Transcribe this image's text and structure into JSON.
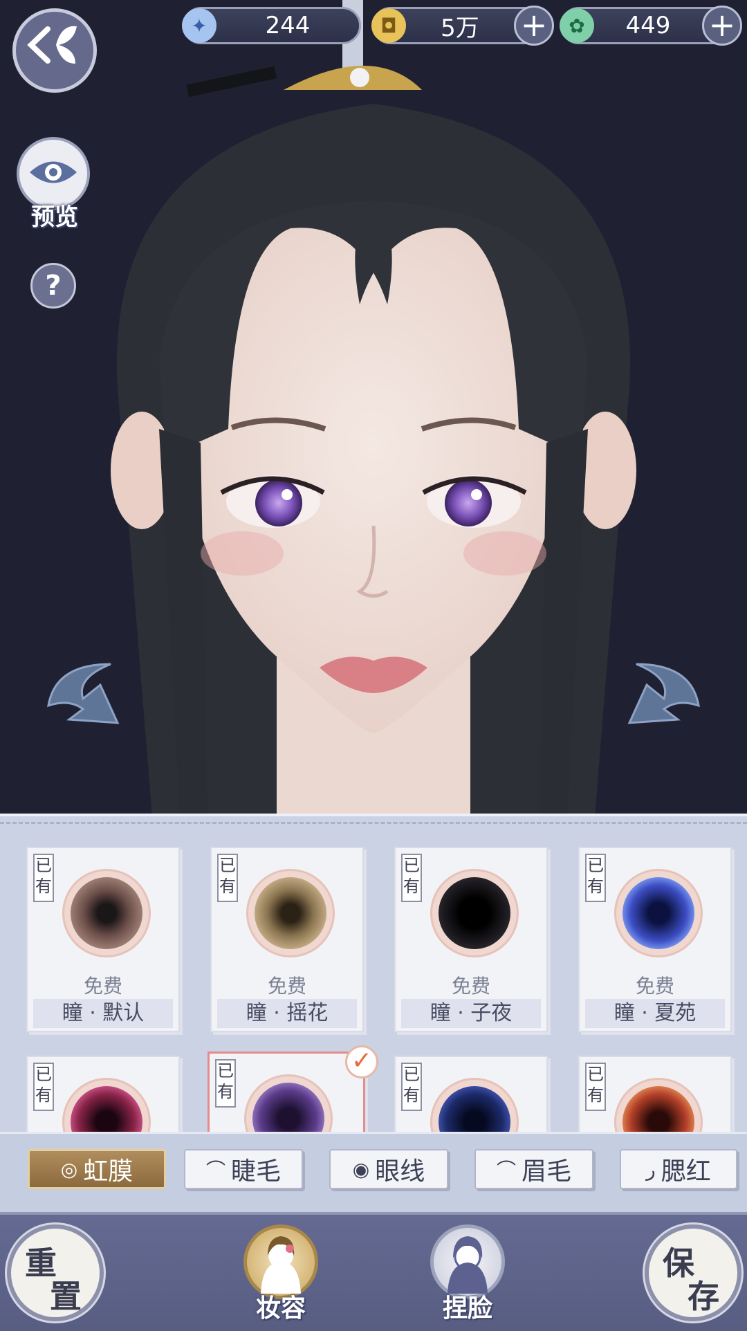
{
  "currencies": [
    {
      "icon": "feather-gem-icon",
      "value": "244",
      "has_plus": false
    },
    {
      "icon": "copper-coin-icon",
      "value": "5万",
      "has_plus": true
    },
    {
      "icon": "jade-token-icon",
      "value": "449",
      "has_plus": true
    }
  ],
  "left": {
    "preview_label": "预览",
    "help_glyph": "?"
  },
  "items": [
    {
      "owned": "已有",
      "price": "免费",
      "name": "瞳 · 默认",
      "color": "#6d4f4a"
    },
    {
      "owned": "已有",
      "price": "免费",
      "name": "瞳 · 摇花",
      "color": "#8a7450"
    },
    {
      "owned": "已有",
      "price": "免费",
      "name": "瞳 · 子夜",
      "color": "#1c1a1f"
    },
    {
      "owned": "已有",
      "price": "免费",
      "name": "瞳 · 夏苑",
      "color": "#3d4ec4"
    },
    {
      "owned": "已有",
      "price": "",
      "name": "",
      "color": "#8a2448"
    },
    {
      "owned": "已有",
      "price": "",
      "name": "",
      "color": "#5b3c8a",
      "selected": true
    },
    {
      "owned": "已有",
      "price": "",
      "name": "",
      "color": "#1d2a6a"
    },
    {
      "owned": "已有",
      "price": "",
      "name": "",
      "color": "#b4402a"
    }
  ],
  "tabs": [
    {
      "label": "虹膜",
      "icon": "iris-icon",
      "glyph": "◎",
      "active": true
    },
    {
      "label": "睫毛",
      "icon": "eyelash-icon",
      "glyph": "⌒",
      "active": false
    },
    {
      "label": "眼线",
      "icon": "eye-icon",
      "glyph": "◉",
      "active": false
    },
    {
      "label": "眉毛",
      "icon": "eyebrow-icon",
      "glyph": "⌒",
      "active": false
    },
    {
      "label": "腮红",
      "icon": "blush-icon",
      "glyph": "ر",
      "active": false
    }
  ],
  "bottom": {
    "reset_chars": [
      "重",
      "置"
    ],
    "save_chars": [
      "保",
      "存"
    ],
    "makeup_label": "妆容",
    "face_label": "捏脸"
  }
}
